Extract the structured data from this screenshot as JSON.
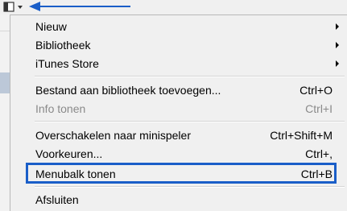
{
  "toolbar": {
    "sidebar_icon": "sidebar-toggle-icon",
    "dropdown_icon": "chevron-down-icon",
    "arrow_icon": "left-arrow-icon"
  },
  "menu": {
    "items": [
      {
        "label": "Nieuw",
        "shortcut": "",
        "submenu": true,
        "disabled": false
      },
      {
        "label": "Bibliotheek",
        "shortcut": "",
        "submenu": true,
        "disabled": false
      },
      {
        "label": "iTunes Store",
        "shortcut": "",
        "submenu": true,
        "disabled": false
      },
      {
        "label": "Bestand aan bibliotheek toevoegen...",
        "shortcut": "Ctrl+O",
        "submenu": false,
        "disabled": false
      },
      {
        "label": "Info tonen",
        "shortcut": "Ctrl+I",
        "submenu": false,
        "disabled": true
      },
      {
        "label": "Overschakelen naar minispeler",
        "shortcut": "Ctrl+Shift+M",
        "submenu": false,
        "disabled": false
      },
      {
        "label": "Voorkeuren...",
        "shortcut": "Ctrl+,",
        "submenu": false,
        "disabled": false
      },
      {
        "label": "Menubalk tonen",
        "shortcut": "Ctrl+B",
        "submenu": false,
        "disabled": false
      },
      {
        "label": "Afsluiten",
        "shortcut": "",
        "submenu": false,
        "disabled": false
      }
    ]
  },
  "colors": {
    "highlight": "#1a5ec8",
    "menu_bg": "#f0f0f0",
    "disabled_text": "#8a8a8a"
  }
}
